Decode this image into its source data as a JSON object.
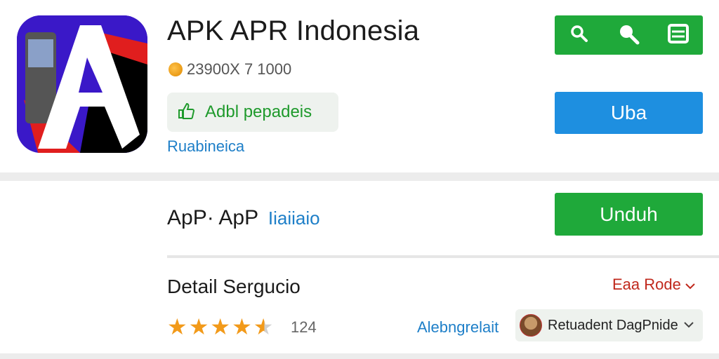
{
  "app": {
    "title": "APK APR Indonesia",
    "price_text": "23900X 7 1000",
    "wishlist_label": "Adbl pepadeis",
    "category": "Ruabineica",
    "subtitle": "ApP· ApP",
    "subtitle_tag": "Iiaiiaio"
  },
  "toolbar": {
    "icons": [
      "search-icon",
      "zoom-icon",
      "menu-icon"
    ]
  },
  "buttons": {
    "primary_label": "Uba",
    "download_label": "Unduh"
  },
  "detail": {
    "title": "Detail Sergucio",
    "sort_label": "Eaa Rode"
  },
  "rating": {
    "stars": 4.5,
    "count": "124"
  },
  "reviewer": {
    "link_label": "Alebngrelait",
    "name": "Retuadent DagPnide"
  },
  "colors": {
    "green": "#1fa93a",
    "blue": "#1e8fe0",
    "red_link": "#c0281c",
    "star": "#f29a1a"
  }
}
